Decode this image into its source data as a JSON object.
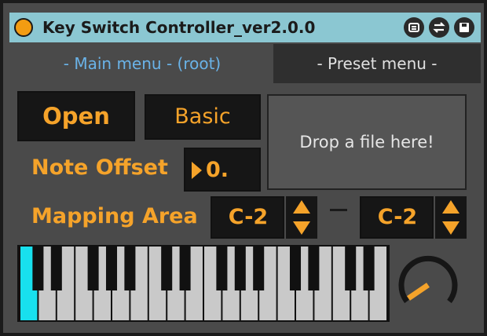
{
  "window": {
    "title": "Key Switch Controller_ver2.0.0"
  },
  "tabs": {
    "main": "- Main menu - (root)",
    "preset": "- Preset menu -"
  },
  "buttons": {
    "open": "Open",
    "basic": "Basic"
  },
  "drop_zone": {
    "text": "Drop a file here!"
  },
  "note_offset": {
    "label": "Note Offset",
    "value": "0."
  },
  "mapping_area": {
    "label": "Mapping Area",
    "low": "C-2",
    "high": "C-2"
  },
  "keyboard": {
    "white_keys": 20,
    "highlighted_key_index": 0,
    "highlight_color": "#18e0ee"
  },
  "colors": {
    "accent": "#f5a32a",
    "titlebar": "#8bc7d2",
    "tab_active_text": "#6ab3e8",
    "panel": "#4a4a4a"
  },
  "icons": {
    "power": "power-dot-icon",
    "title_buttons": [
      "device-icon",
      "swap-icon",
      "save-icon"
    ]
  }
}
